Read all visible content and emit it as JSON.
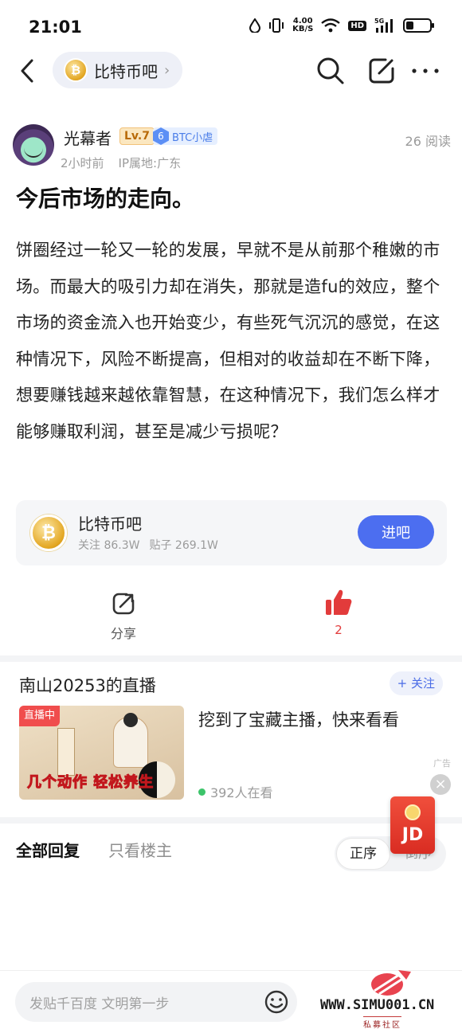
{
  "status_bar": {
    "time": "21:01",
    "net_speed_value": "4.00",
    "net_speed_unit": "KB/S",
    "hd": "HD",
    "network": "5G",
    "icons": [
      "water-drop-icon",
      "vibrate-icon",
      "wifi-icon",
      "signal-icon",
      "battery-icon"
    ]
  },
  "nav": {
    "forum_name": "比特币吧",
    "icons": [
      "back-icon",
      "search-icon",
      "edit-icon",
      "more-icon"
    ]
  },
  "post": {
    "author": "光幕者",
    "level": "Lv.7",
    "honor_level": "6",
    "honor_title": "BTC小虐",
    "time": "2小时前",
    "ip_location": "IP属地:广东",
    "read_count": "26 阅读",
    "title": "今后市场的走向。",
    "body": "饼圈经过一轮又一轮的发展，早就不是从前那个稚嫩的市场。而最大的吸引力却在消失，那就是造fu的效应，整个市场的资金流入也开始变少，有些死气沉沉的感觉，在这种情况下，风险不断提高，但相对的收益却在不断下降，想要赚钱越来越依靠智慧，在这种情况下，我们怎么样才能够赚取利润，甚至是减少亏损呢？"
  },
  "forum_card": {
    "name": "比特币吧",
    "followers": "关注 86.3W",
    "posts": "贴子 269.1W",
    "enter_label": "进吧"
  },
  "actions": {
    "share_label": "分享",
    "like_count": "2"
  },
  "live": {
    "header": "南山20253的直播",
    "follow_label": "+ 关注",
    "tag": "直播中",
    "thumb_caption": "几个动作 轻松养生",
    "title": "挖到了宝藏主播，快来看看",
    "viewers": "392人在看",
    "ad_label": "广告"
  },
  "replies": {
    "tab_all": "全部回复",
    "tab_op": "只看楼主",
    "sort_asc": "正序",
    "sort_desc": "倒序"
  },
  "jd_float": {
    "label": "JD"
  },
  "bottom": {
    "placeholder": "发贴千百度 文明第一步"
  },
  "watermark": {
    "url": "WWW.SIMU001.CN",
    "sub": "私募社区"
  },
  "colors": {
    "accent_blue": "#4c6ef0",
    "like_red": "#e23b3b",
    "live_red": "#f04d4d"
  }
}
